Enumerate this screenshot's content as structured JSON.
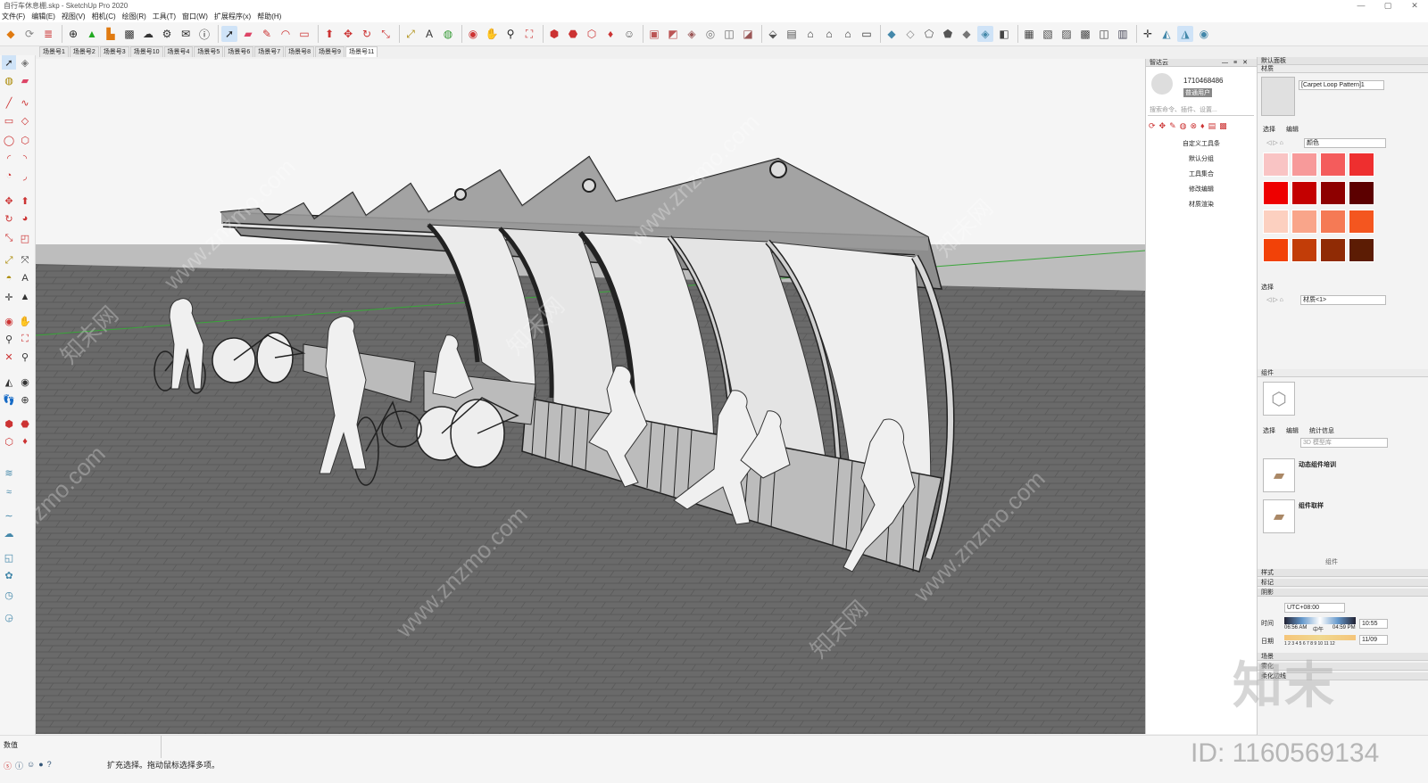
{
  "window": {
    "title": "自行车休息棚.skp - SketchUp Pro 2020",
    "controls": [
      "—",
      "▢",
      "✕"
    ]
  },
  "menu": [
    "文件(F)",
    "编辑(E)",
    "视图(V)",
    "相机(C)",
    "绘图(R)",
    "工具(T)",
    "窗口(W)",
    "扩展程序(x)",
    "帮助(H)"
  ],
  "scene_tabs": [
    "场景号1",
    "场景号2",
    "场景号3",
    "场景号10",
    "场景号4",
    "场景号5",
    "场景号6",
    "场景号7",
    "场景号8",
    "场景号9",
    "场景号11"
  ],
  "active_scene": "场景号11",
  "plugin_panel": {
    "title": "智达云",
    "user_id": "1710468486",
    "user_badge": "普通用户",
    "search_placeholder": "搜索命令、插件、设置...",
    "menu_items": [
      "自定义工具条",
      "默认分组",
      "工具集合",
      "修改编辑",
      "材质渲染"
    ]
  },
  "tray": {
    "title": "默认面板",
    "materials": {
      "header": "材质",
      "current_name": "[Carpet Loop Pattern]1",
      "tab_select": "选择",
      "tab_edit": "编辑",
      "library": "颜色",
      "select_header": "选择",
      "model_material": "材质<1>",
      "swatches": [
        "#f9c4c4",
        "#f79a9a",
        "#f45c5c",
        "#ee2f2f",
        "#ee0000",
        "#c40000",
        "#8e0000",
        "#5c0000",
        "#fcd0c0",
        "#f9a58a",
        "#f57a55",
        "#f4561f",
        "#f24208",
        "#c23d08",
        "#902b05",
        "#5c1c04"
      ]
    },
    "components": {
      "header": "组件",
      "tab_select": "选择",
      "tab_edit": "编辑",
      "tab_stats": "统计信息",
      "search_placeholder": "3D 模型库",
      "items": [
        "动态组件培训",
        "组件取样"
      ],
      "footer": "组件"
    },
    "styles_header": "样式",
    "tags_header": "标记",
    "shadows": {
      "header": "阴影",
      "timezone": "UTC+08:00",
      "time_label": "时间",
      "time_start": "06:56 AM",
      "time_noon": "中午",
      "time_end": "04:59 PM",
      "time_value": "10:55",
      "date_label": "日期",
      "date_months": "1 2 3 4 5 6 7 8 9 10 11 12",
      "date_value": "11/09"
    },
    "scenes_header": "场景",
    "fog_header": "雾化",
    "soften_header": "柔化边线"
  },
  "status": {
    "measurements_label": "数值",
    "hint": "扩充选择。拖动鼠标选择多项。"
  },
  "watermarks": [
    "www.znzmo.com",
    "知末网",
    "znzmo.com"
  ],
  "brand_logo": "知末",
  "image_id": "ID: 1160569134",
  "colors": {
    "viewport_sky": "#f5f5f5",
    "ground": "#6c6c6c",
    "accent_red": "#e03030"
  }
}
